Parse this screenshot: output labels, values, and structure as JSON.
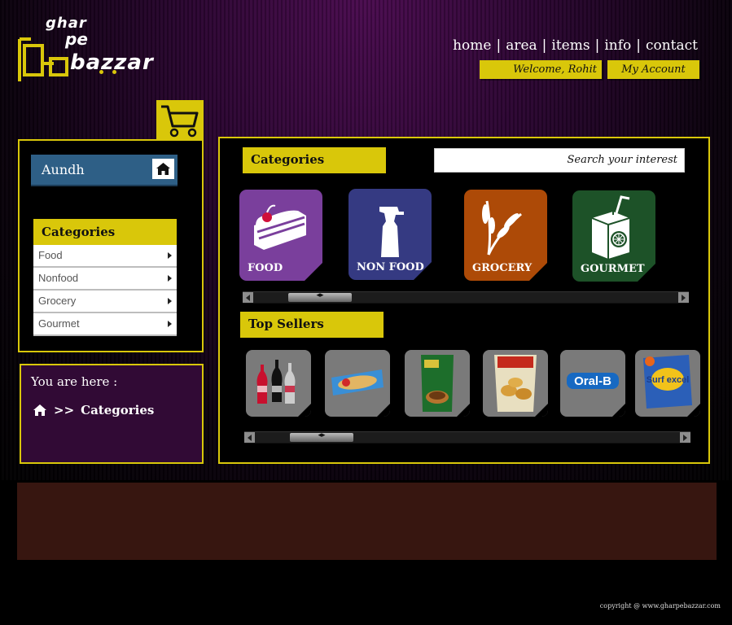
{
  "logo": {
    "line1": "ghar",
    "line2": "pe",
    "line3": "bazzar"
  },
  "nav": {
    "items": [
      "home",
      "area",
      "items",
      "info",
      "contact"
    ]
  },
  "header": {
    "welcome": "Welcome, Rohit",
    "account": "My Account"
  },
  "sidebar": {
    "area": "Aundh",
    "categories_title": "Categories",
    "categories": [
      "Food",
      "Nonfood",
      "Grocery",
      "Gourmet"
    ]
  },
  "breadcrumb": {
    "title": "You are here :",
    "sep": ">>",
    "current": "Categories"
  },
  "main": {
    "categories_title": "Categories",
    "search_placeholder": "Search your interest",
    "tiles": [
      {
        "label": "FOOD",
        "color": "#7a3f9c",
        "icon": "cake-icon"
      },
      {
        "label": "NON FOOD",
        "color": "#353a82",
        "icon": "spray-bottle-icon"
      },
      {
        "label": "GROCERY",
        "color": "#ad4a07",
        "icon": "wheat-icon"
      },
      {
        "label": "GOURMET",
        "color": "#1d5228",
        "icon": "juice-box-icon"
      }
    ],
    "top_sellers_title": "Top Sellers",
    "products": [
      "coke-bottles-image",
      "biscuit-pack-image",
      "coffee-pack-image",
      "chips-pack-image",
      "oral-b-logo-image",
      "surf-excel-pack-image"
    ],
    "product_logo_text": {
      "oralb": "Oral-B",
      "surf": "Surf excel"
    }
  },
  "footer": {
    "copyright": "copyright @ www.gharpebazzar.com"
  },
  "colors": {
    "accent": "#d9c70a",
    "area_box": "#2e5f86",
    "here_bg": "#310a35",
    "footer_band": "#371610"
  }
}
